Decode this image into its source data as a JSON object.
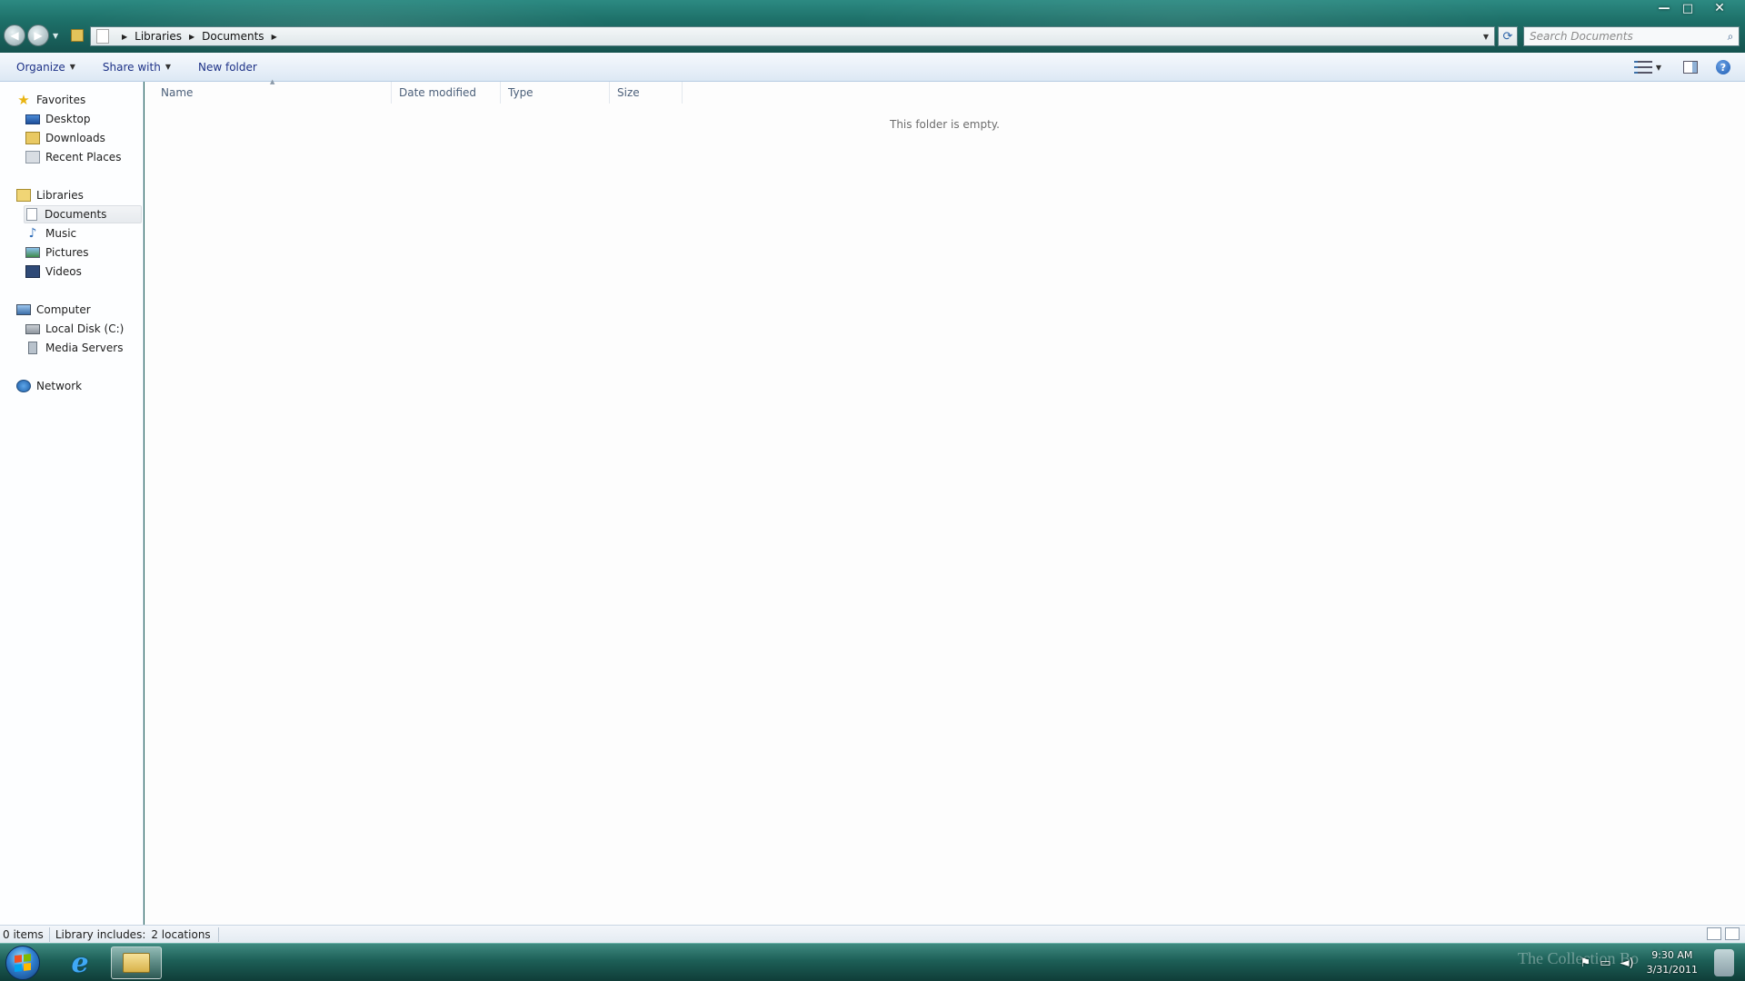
{
  "window": {
    "minimize_glyph": "—",
    "maximize_glyph": "□",
    "close_glyph": "✕"
  },
  "nav": {
    "back_glyph": "◀",
    "forward_glyph": "▶"
  },
  "address": {
    "crumbs": [
      "Libraries",
      "Documents"
    ],
    "separator": "▶"
  },
  "search": {
    "placeholder": "Search Documents"
  },
  "toolbar": {
    "organize": "Organize",
    "share_with": "Share with",
    "new_folder": "New folder"
  },
  "sidebar": {
    "favorites": {
      "label": "Favorites",
      "items": [
        "Desktop",
        "Downloads",
        "Recent Places"
      ]
    },
    "libraries": {
      "label": "Libraries",
      "items": [
        "Documents",
        "Music",
        "Pictures",
        "Videos"
      ],
      "selected": "Documents"
    },
    "computer": {
      "label": "Computer",
      "items": [
        "Local Disk (C:)",
        "Media Servers"
      ]
    },
    "network": {
      "label": "Network"
    }
  },
  "columns": [
    "Name",
    "Date modified",
    "Type",
    "Size"
  ],
  "empty_message": "This folder is empty.",
  "status": {
    "items": "0 items",
    "library_includes": "Library includes:",
    "locations": "2 locations"
  },
  "taskbar": {
    "watermark": "The Collection Bo",
    "clock": {
      "time": "9:30 AM",
      "date": "3/31/2011"
    }
  },
  "icons": {
    "start": "windows-logo",
    "ie": "internet-explorer",
    "explorer": "folder"
  }
}
